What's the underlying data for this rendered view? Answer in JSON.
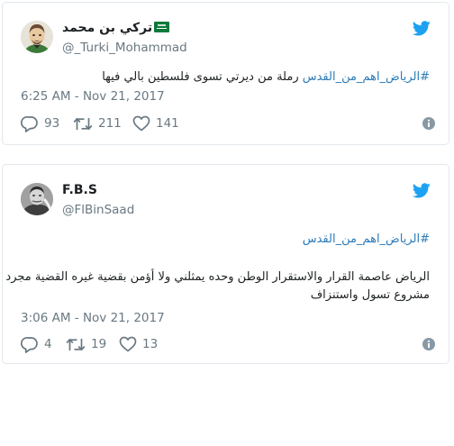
{
  "tweets": [
    {
      "display_name": "تركي بن محمد",
      "handle": "@_Turki_Mohammad",
      "hashtag": "#الرياض_اهم_من_القدس",
      "text": " رملة من ديرتي تسوى فلسطين بالي فيها",
      "timestamp": "6:25 AM - Nov 21, 2017",
      "replies": "93",
      "retweets": "211",
      "likes": "141",
      "colors": {
        "accent": "#1da1f2",
        "link": "#2b7bb9"
      }
    },
    {
      "display_name": "F.B.S",
      "handle": "@FlBinSaad",
      "hashtag": "#الرياض_اهم_من_القدس",
      "line1": "الرياض عاصمة القرار والاستقرار الوطن وحده يمثلني ولا أؤمن بقضية غيره القضية مجرد",
      "line2": "مشروع تسول واستنزاف",
      "timestamp": "3:06 AM - Nov 21, 2017",
      "replies": "4",
      "retweets": "19",
      "likes": "13"
    }
  ],
  "icons": [
    "twitter-bird-icon",
    "reply-icon",
    "retweet-icon",
    "like-heart-icon",
    "info-icon",
    "saudi-flag-emoji"
  ]
}
